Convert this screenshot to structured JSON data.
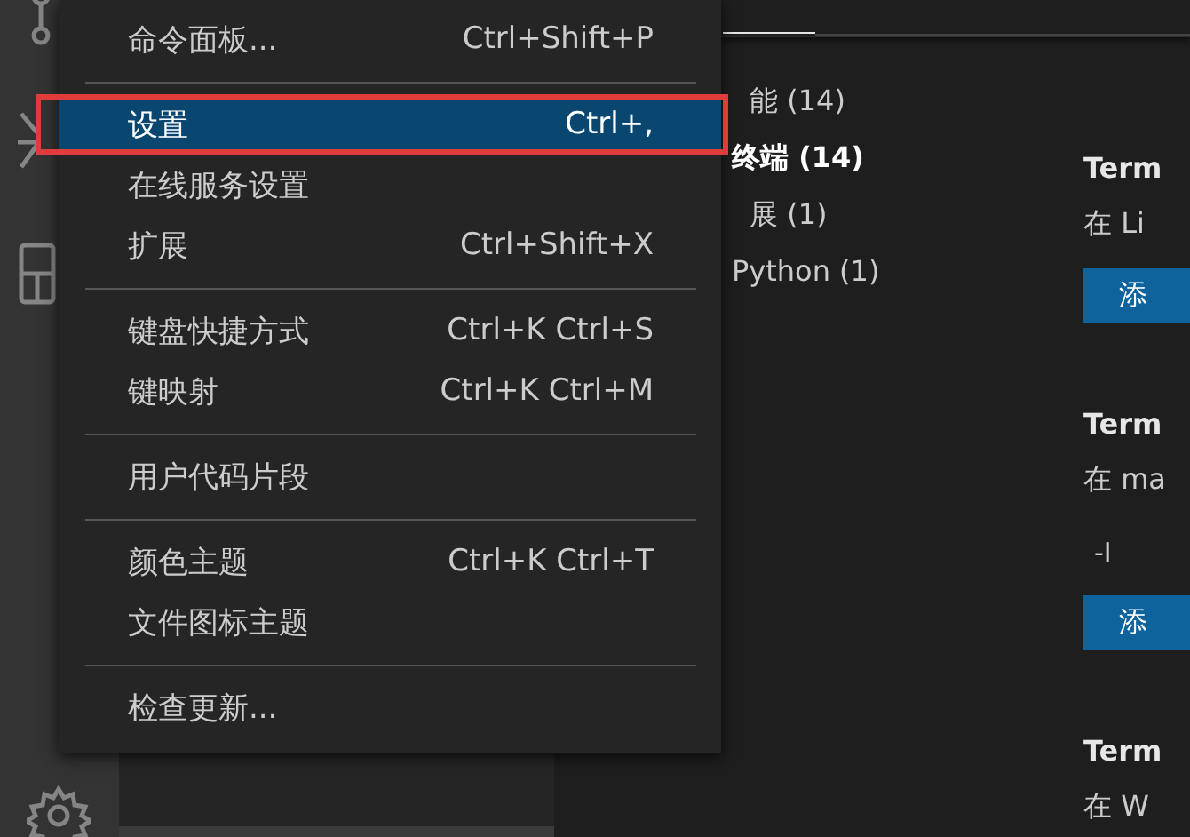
{
  "menu": [
    {
      "kind": "item",
      "label": "命令面板...",
      "shortcut": "Ctrl+Shift+P",
      "selected": false
    },
    {
      "kind": "separator"
    },
    {
      "kind": "item",
      "label": "设置",
      "shortcut": "Ctrl+,",
      "selected": true
    },
    {
      "kind": "item",
      "label": "在线服务设置",
      "selected": false
    },
    {
      "kind": "item",
      "label": "扩展",
      "shortcut": "Ctrl+Shift+X",
      "selected": false
    },
    {
      "kind": "separator"
    },
    {
      "kind": "item",
      "label": "键盘快捷方式",
      "shortcut": "Ctrl+K Ctrl+S",
      "selected": false
    },
    {
      "kind": "item",
      "label": "键映射",
      "shortcut": "Ctrl+K Ctrl+M",
      "selected": false
    },
    {
      "kind": "separator"
    },
    {
      "kind": "item",
      "label": "用户代码片段",
      "selected": false
    },
    {
      "kind": "separator"
    },
    {
      "kind": "item",
      "label": "颜色主题",
      "shortcut": "Ctrl+K Ctrl+T",
      "selected": false
    },
    {
      "kind": "item",
      "label": "文件图标主题",
      "selected": false
    },
    {
      "kind": "separator"
    },
    {
      "kind": "item",
      "label": "检查更新...",
      "selected": false
    }
  ],
  "settings_tree": [
    {
      "label": "能 (14)",
      "selected": false,
      "children": [
        {
          "label": "终端 (14)",
          "selected": true
        }
      ]
    },
    {
      "label": "展 (1)",
      "selected": false,
      "children": [
        {
          "label": "Python (1)",
          "selected": false
        }
      ]
    }
  ],
  "settings": [
    {
      "title": "Term",
      "description": "在 Li",
      "button": "添"
    },
    {
      "title": "Term",
      "description": "在 ma",
      "value": "-I",
      "button": "添"
    },
    {
      "title": "Term",
      "description": "在 W"
    }
  ]
}
